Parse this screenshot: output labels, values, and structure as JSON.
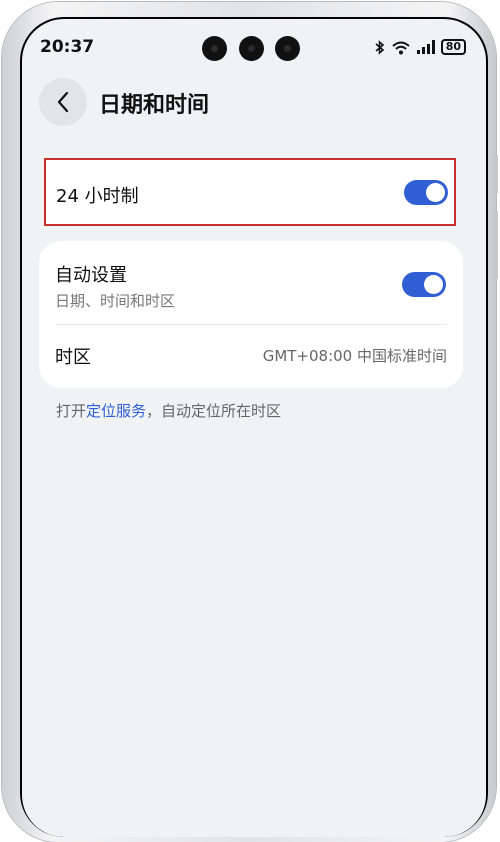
{
  "status_bar": {
    "time": "20:37",
    "battery": "80",
    "icons": [
      "bluetooth-icon",
      "wifi-icon",
      "signal-icon",
      "battery-icon"
    ]
  },
  "header": {
    "title": "日期和时间",
    "back_icon": "chevron-left-icon"
  },
  "settings": {
    "hour24": {
      "label": "24 小时制",
      "enabled": true
    },
    "auto": {
      "label": "自动设置",
      "sublabel": "日期、时间和时区",
      "enabled": true
    },
    "timezone": {
      "label": "时区",
      "value": "GMT+08:00 中国标准时间"
    }
  },
  "footnote": {
    "prefix": "打开",
    "link": "定位服务",
    "suffix": "，自动定位所在时区"
  },
  "colors": {
    "accent": "#2f5fd3",
    "highlight_border": "#c8312b",
    "background": "#f1f2f4"
  }
}
